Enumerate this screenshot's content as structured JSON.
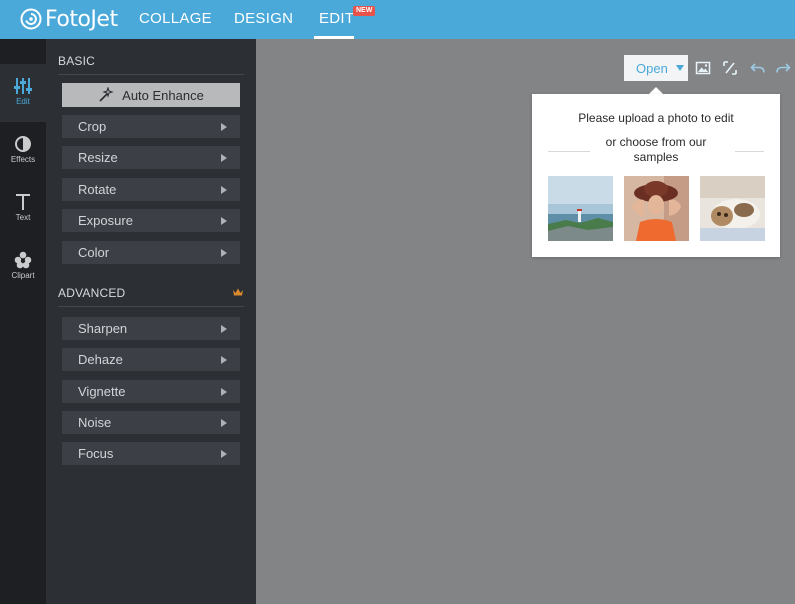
{
  "app": {
    "logo_text": "FotoJet"
  },
  "nav": {
    "collage": "COLLAGE",
    "design": "DESIGN",
    "edit": "EDIT",
    "new_badge": "NEW"
  },
  "rail": [
    {
      "label": "Edit",
      "icon": "sliders-icon",
      "active": true
    },
    {
      "label": "Effects",
      "icon": "half-circle-icon"
    },
    {
      "label": "Text",
      "icon": "text-t-icon"
    },
    {
      "label": "Clipart",
      "icon": "flower-icon"
    }
  ],
  "panel": {
    "basic_heading": "BASIC",
    "auto_enhance": "Auto Enhance",
    "basic_items": [
      "Crop",
      "Resize",
      "Rotate",
      "Exposure",
      "Color"
    ],
    "advanced_heading": "ADVANCED",
    "advanced_items": [
      "Sharpen",
      "Dehaze",
      "Vignette",
      "Noise",
      "Focus"
    ]
  },
  "toolbar": {
    "open_label": "Open"
  },
  "popover": {
    "title": "Please upload a photo to edit",
    "subtitle": "or choose from our samples"
  },
  "colors": {
    "accent": "#4aa9d9",
    "workspace": "#838486",
    "panel": "#2c2f34",
    "rail": "#1d1f22",
    "badge": "#e8534a"
  }
}
